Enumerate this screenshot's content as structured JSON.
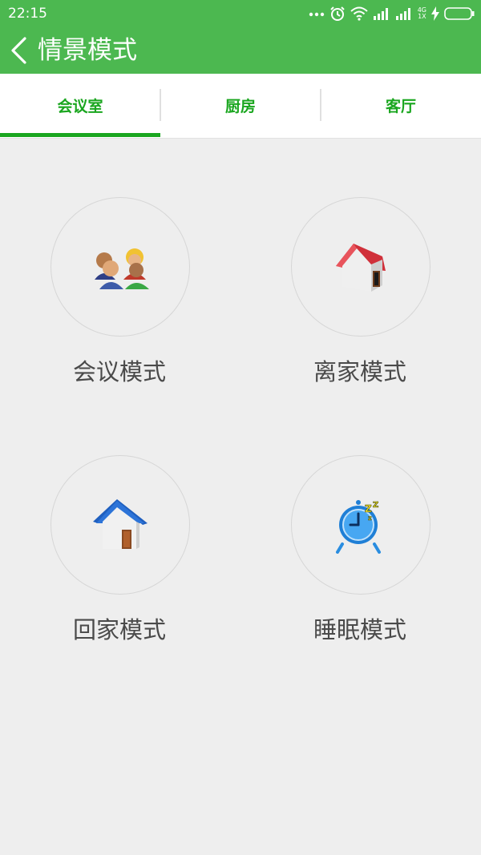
{
  "status_bar": {
    "time": "22:15",
    "network_top": "4G",
    "network_bottom": "1X",
    "icons": [
      "more-dots-icon",
      "alarm-icon",
      "wifi-icon",
      "signal-icon",
      "signal-2-icon",
      "charging-icon",
      "battery-icon"
    ]
  },
  "app_bar": {
    "title": "情景模式",
    "back_icon": "chevron-left-icon"
  },
  "tabs": [
    {
      "label": "会议室",
      "selected": true
    },
    {
      "label": "厨房",
      "selected": false
    },
    {
      "label": "客厅",
      "selected": false
    }
  ],
  "scenes": [
    {
      "label": "会议模式",
      "icon": "meeting-people-icon"
    },
    {
      "label": "离家模式",
      "icon": "red-house-icon"
    },
    {
      "label": "回家模式",
      "icon": "blue-house-icon"
    },
    {
      "label": "睡眠模式",
      "icon": "alarm-clock-sleep-icon"
    }
  ],
  "colors": {
    "primary": "#4cb850",
    "tab_text": "#1aa61f",
    "background": "#eeeeee"
  }
}
